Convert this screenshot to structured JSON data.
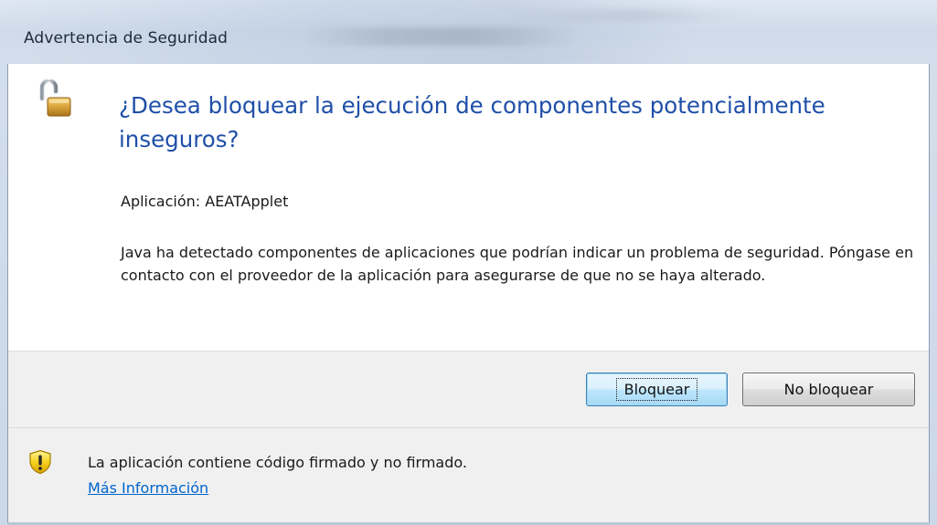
{
  "window": {
    "title": "Advertencia de Seguridad"
  },
  "dialog": {
    "heading": "¿Desea bloquear la ejecución de componentes potencialmente inseguros?",
    "application_label": "Aplicación:",
    "application_name": "AEATApplet",
    "description": "Java ha detectado componentes de aplicaciones que podrían indicar un problema de seguridad. Póngase en contacto con el proveedor de la aplicación para asegurarse de que no se haya alterado."
  },
  "buttons": {
    "block_label": "Bloquear",
    "no_block_label": "No bloquear"
  },
  "footer": {
    "warning_text": "La aplicación contiene código firmado y no firmado.",
    "more_info_link": "Más Información"
  },
  "icons": {
    "heading_icon": "unlocked-padlock-icon",
    "footer_icon": "warning-shield-icon"
  },
  "colors": {
    "heading": "#1f4fa8",
    "link": "#0066cc",
    "band": "#f0f0f0"
  }
}
